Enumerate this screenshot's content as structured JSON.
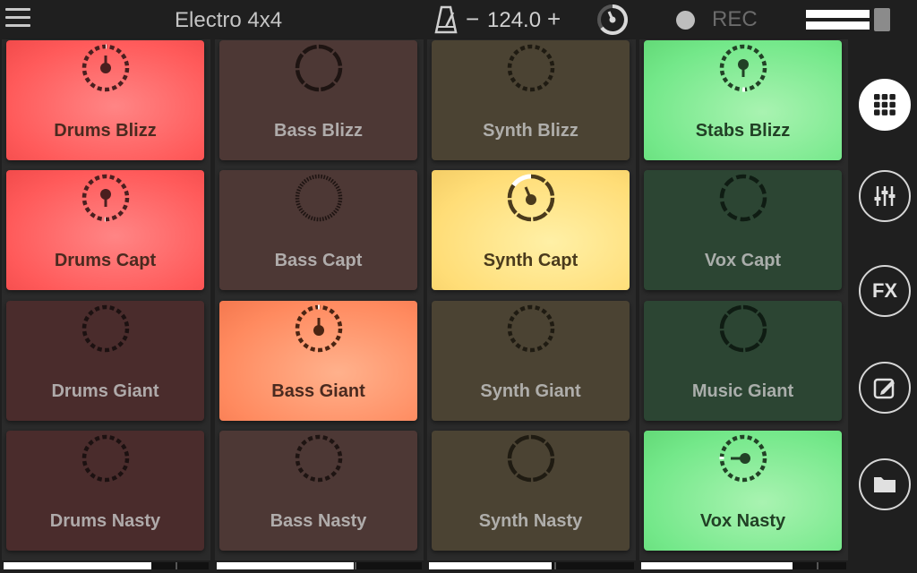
{
  "header": {
    "title": "Electro 4x4",
    "tempo_minus": "−",
    "tempo_value": "124.0",
    "tempo_plus": "+",
    "rec_label": "REC",
    "icons": [
      "menu-icon",
      "metronome-icon",
      "tempo-dial-icon",
      "record-dot-icon",
      "level-meter"
    ]
  },
  "columns": [
    {
      "volume": 0.72,
      "pads": [
        {
          "label": "Drums Blizz",
          "state": "playing",
          "color": "#ff5a5a"
        },
        {
          "label": "Drums Capt",
          "state": "playing",
          "color": "#ff5a5a"
        },
        {
          "label": "Drums Giant",
          "state": "stopped",
          "color": "#4a2c2c"
        },
        {
          "label": "Drums Nasty",
          "state": "stopped",
          "color": "#4a2c2c"
        }
      ]
    },
    {
      "volume": 0.67,
      "pads": [
        {
          "label": "Bass Blizz",
          "state": "stopped",
          "color": "#4d3835"
        },
        {
          "label": "Bass Capt",
          "state": "stopped",
          "color": "#4d3835"
        },
        {
          "label": "Bass Giant",
          "state": "playing",
          "color": "#ff8a5f"
        },
        {
          "label": "Bass Nasty",
          "state": "stopped",
          "color": "#4d3835"
        }
      ]
    },
    {
      "volume": 0.6,
      "pads": [
        {
          "label": "Synth Blizz",
          "state": "stopped",
          "color": "#4b4333"
        },
        {
          "label": "Synth Capt",
          "state": "playing",
          "color": "#ffdd77"
        },
        {
          "label": "Synth Giant",
          "state": "stopped",
          "color": "#4b4333"
        },
        {
          "label": "Synth Nasty",
          "state": "stopped",
          "color": "#4b4333"
        }
      ]
    },
    {
      "volume": 0.74,
      "pads": [
        {
          "label": "Stabs Blizz",
          "state": "playing",
          "color": "#74e88a"
        },
        {
          "label": "Vox Capt",
          "state": "stopped",
          "color": "#2c4533"
        },
        {
          "label": "Music Giant",
          "state": "stopped",
          "color": "#2c4533"
        },
        {
          "label": "Vox Nasty",
          "state": "playing",
          "color": "#74e88a"
        }
      ]
    }
  ],
  "sidebar": {
    "selected": "grid",
    "fx_label": "FX",
    "buttons": [
      "grid-icon",
      "mixer-icon",
      "fx-icon",
      "edit-icon",
      "folder-icon"
    ]
  }
}
